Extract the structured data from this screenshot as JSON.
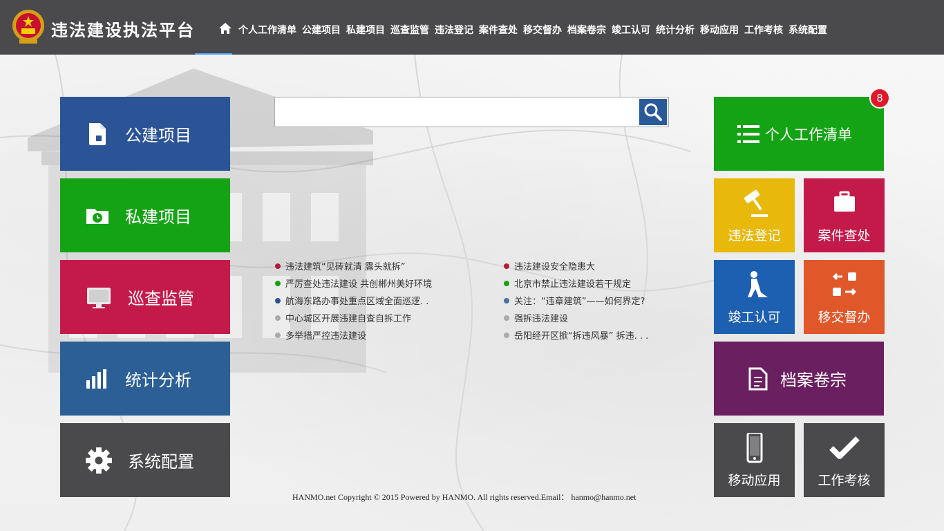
{
  "header": {
    "app_title": "违法建设执法平台",
    "nav": [
      "个人工作清单",
      "公建项目",
      "私建项目",
      "巡查监管",
      "违法登记",
      "案件查处",
      "移交督办",
      "档案卷宗",
      "竣工认可",
      "统计分析",
      "移动应用",
      "工作考核",
      "系统配置"
    ]
  },
  "left_tiles": [
    {
      "label": "公建项目",
      "icon": "document-icon",
      "color": "#2b5496"
    },
    {
      "label": "私建项目",
      "icon": "folder-clock-icon",
      "color": "#14a314"
    },
    {
      "label": "巡查监管",
      "icon": "monitor-icon",
      "color": "#c41a4a"
    },
    {
      "label": "统计分析",
      "icon": "bar-chart-icon",
      "color": "#2b5f96"
    },
    {
      "label": "系统配置",
      "icon": "gear-icon",
      "color": "#4a4a4c"
    }
  ],
  "search": {
    "placeholder": "",
    "value": ""
  },
  "news": {
    "left": [
      {
        "text": "违法建筑“见砖就清 露头就拆”",
        "color": "#b01c3c"
      },
      {
        "text": "严厉查处违法建设 共创郴州美好环境",
        "color": "#14a314"
      },
      {
        "text": "航海东路办事处重点区域全面巡逻. .",
        "color": "#2b5496"
      },
      {
        "text": "中心城区开展违建自查自拆工作",
        "color": "#aaaaaa"
      },
      {
        "text": "多举措严控违法建设",
        "color": "#aaaaaa"
      }
    ],
    "right": [
      {
        "text": "违法建设安全隐患大",
        "color": "#b01c3c"
      },
      {
        "text": "北京市禁止违法建设若干规定",
        "color": "#14a314"
      },
      {
        "text": "关注：“违章建筑”——如何界定?",
        "color": "#4a6fa5"
      },
      {
        "text": "强拆违法建设",
        "color": "#aaaaaa"
      },
      {
        "text": "岳阳经开区掀“拆违风暴” 拆违. . .",
        "color": "#aaaaaa"
      }
    ]
  },
  "footer": "HANMO.net Copyright © 2015 Powered by HANMO. All rights reserved.Email： hanmo@hanmo.net",
  "right_tiles": {
    "work_list": {
      "label": "个人工作清单",
      "badge": "8",
      "color": "#14a314"
    },
    "register": {
      "label": "违法登记",
      "color": "#e8b80a"
    },
    "case": {
      "label": "案件查处",
      "color": "#c41a4a"
    },
    "completion": {
      "label": "竣工认可",
      "color": "#1d5fb0"
    },
    "transfer": {
      "label": "移交督办",
      "color": "#e0572a"
    },
    "archive": {
      "label": "档案卷宗",
      "color": "#6a1f60"
    },
    "mobile": {
      "label": "移动应用",
      "color": "#4a4a4c"
    },
    "assessment": {
      "label": "工作考核",
      "color": "#4a4a4c"
    }
  }
}
